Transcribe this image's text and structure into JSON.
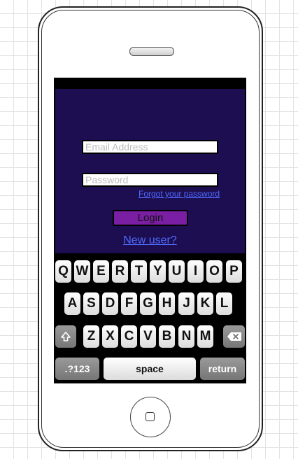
{
  "form": {
    "email_placeholder": "Email Address",
    "password_placeholder": "Password",
    "forgot_link": "Forgot your password",
    "login_label": "Login",
    "new_user_link": "New user?"
  },
  "keyboard": {
    "row1": [
      "Q",
      "W",
      "E",
      "R",
      "T",
      "Y",
      "U",
      "I",
      "O",
      "P"
    ],
    "row2": [
      "A",
      "S",
      "D",
      "F",
      "G",
      "H",
      "J",
      "K",
      "L"
    ],
    "row3": [
      "Z",
      "X",
      "C",
      "V",
      "B",
      "N",
      "M"
    ],
    "shift_icon": "shift-arrow-icon",
    "backspace_icon": "backspace-icon",
    "numbers_label": ".?123",
    "space_label": "space",
    "return_label": "return"
  },
  "colors": {
    "app_background": "#1d0e52",
    "login_button": "#7a1fa3",
    "link": "#4f6bff"
  }
}
